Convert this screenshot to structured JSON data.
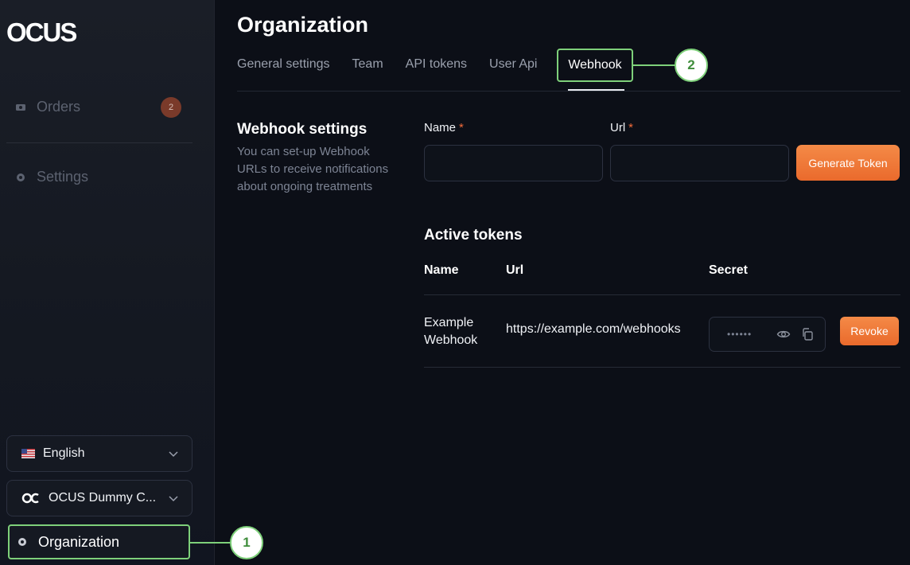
{
  "brand": {
    "logo_text": "OCUS"
  },
  "sidebar": {
    "items": [
      {
        "label": "Orders",
        "icon": "orders-icon",
        "badge": "2"
      },
      {
        "label": "Settings",
        "icon": "settings-icon"
      }
    ],
    "language": {
      "label": "English",
      "icon": "us-flag-icon"
    },
    "company": {
      "label": "OCUS Dummy C...",
      "icon": "ocus-logo-icon"
    },
    "organization": {
      "label": "Organization",
      "icon": "organization-icon"
    }
  },
  "header": {
    "title": "Organization",
    "tabs": [
      {
        "label": "General settings"
      },
      {
        "label": "Team"
      },
      {
        "label": "API tokens"
      },
      {
        "label": "User Api"
      },
      {
        "label": "Webhook",
        "active": true
      }
    ]
  },
  "webhook": {
    "title": "Webhook settings",
    "description": "You can set-up Webhook URLs to receive notifications about ongoing treatments",
    "name_label": "Name",
    "url_label": "Url",
    "required_mark": "*",
    "name_value": "",
    "url_value": "",
    "generate_label": "Generate Token"
  },
  "tokens": {
    "title": "Active tokens",
    "columns": [
      "Name",
      "Url",
      "Secret"
    ],
    "rows": [
      {
        "name": "Example Webhook",
        "url": "https://example.com/webhooks",
        "secret_masked": "••••••",
        "revoke_label": "Revoke"
      }
    ]
  },
  "callouts": [
    "1",
    "2"
  ],
  "colors": {
    "accent": "#ee7433",
    "highlight": "#7ed07a",
    "background": "#0c0f17"
  }
}
